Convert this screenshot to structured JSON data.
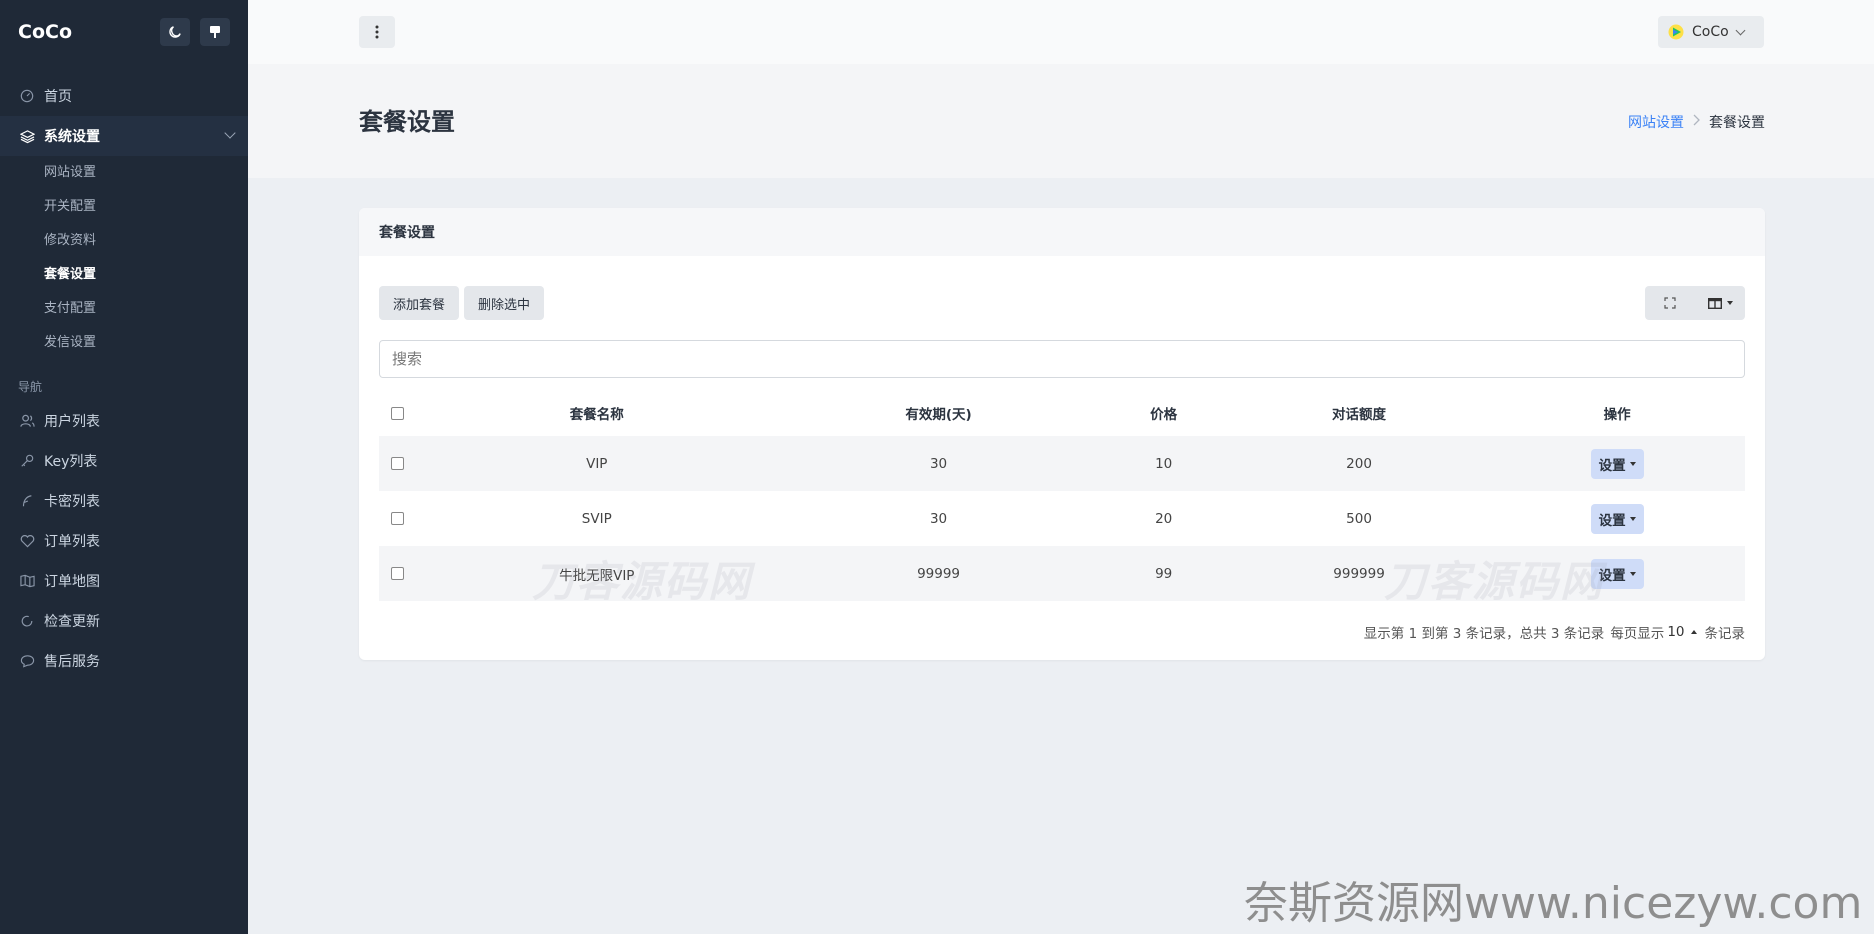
{
  "brand": "CoCo",
  "sidebar": {
    "home": "首页",
    "system": "系统设置",
    "sub_items": [
      "网站设置",
      "开关配置",
      "修改资料",
      "套餐设置",
      "支付配置",
      "发信设置"
    ],
    "nav_heading": "导航",
    "nav_items": [
      "用户列表",
      "Key列表",
      "卡密列表",
      "订单列表",
      "订单地图",
      "检查更新",
      "售后服务"
    ]
  },
  "topbar": {
    "user_name": "CoCo"
  },
  "page": {
    "title": "套餐设置",
    "breadcrumb_link": "网站设置",
    "breadcrumb_current": "套餐设置"
  },
  "card": {
    "title": "套餐设置",
    "add_label": "添加套餐",
    "delete_label": "删除选中",
    "search_placeholder": "搜索"
  },
  "table": {
    "headers": [
      "套餐名称",
      "有效期(天)",
      "价格",
      "对话额度",
      "操作"
    ],
    "rows": [
      {
        "name": "VIP",
        "days": "30",
        "price": "10",
        "quota": "200",
        "action": "设置"
      },
      {
        "name": "SVIP",
        "days": "30",
        "price": "20",
        "quota": "500",
        "action": "设置"
      },
      {
        "name": "牛批无限VIP",
        "days": "99999",
        "price": "99",
        "quota": "999999",
        "action": "设置"
      }
    ]
  },
  "pager": {
    "summary": "显示第 1 到第 3 条记录，总共 3 条记录",
    "per_page_prefix": "每页显示",
    "per_page": "10",
    "per_page_suffix": "条记录"
  },
  "watermarks": {
    "overlay": "刀客源码网",
    "bottom": "奈斯资源网www.nicezyw.com"
  }
}
